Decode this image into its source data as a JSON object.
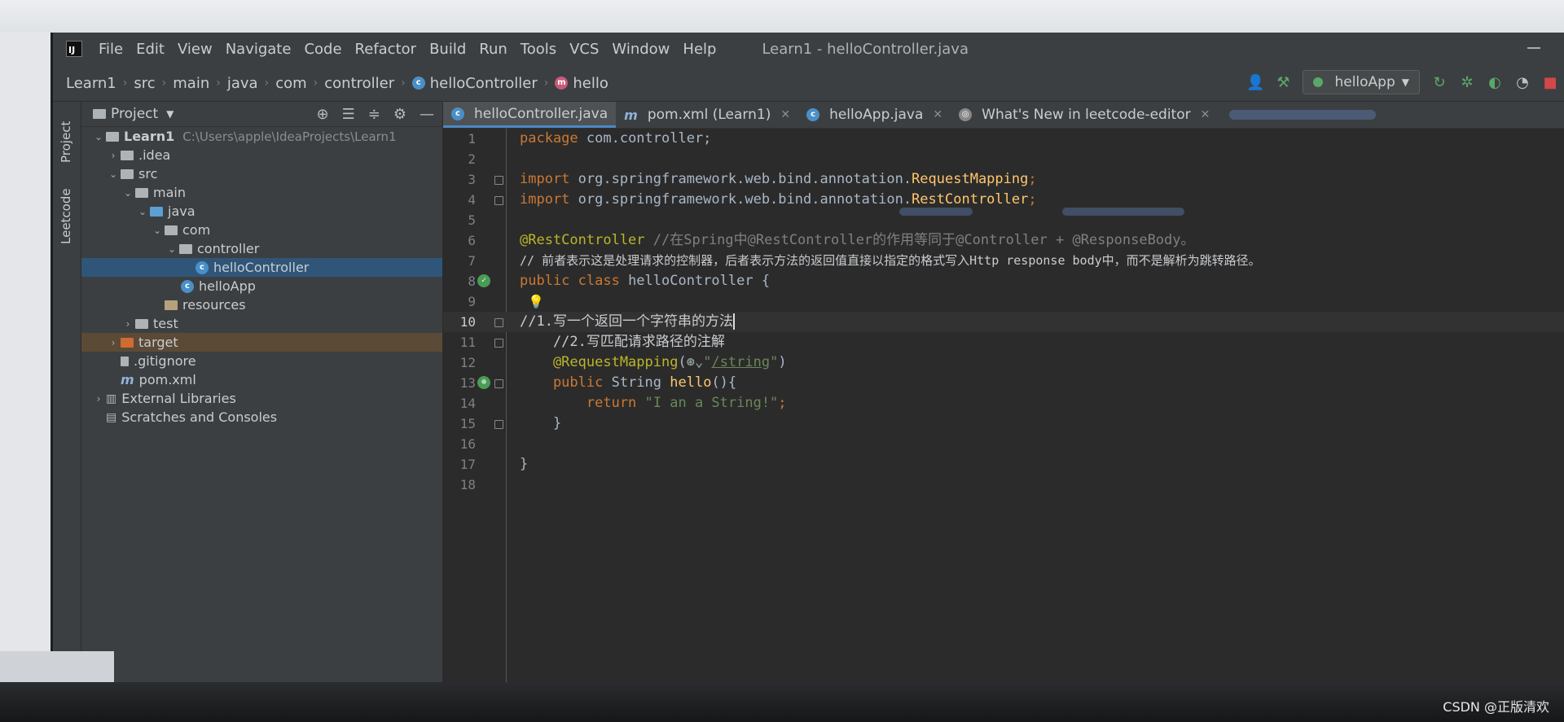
{
  "menu": {
    "items": [
      "File",
      "Edit",
      "View",
      "Navigate",
      "Code",
      "Refactor",
      "Build",
      "Run",
      "Tools",
      "VCS",
      "Window",
      "Help"
    ],
    "window_title": "Learn1 - helloController.java"
  },
  "breadcrumb": [
    "Learn1",
    "src",
    "main",
    "java",
    "com",
    "controller",
    "helloController",
    "hello"
  ],
  "toolbar": {
    "run_config": "helloApp"
  },
  "sidebar": {
    "project_label": "Project",
    "leetcode_label": "Leetcode"
  },
  "project": {
    "header": "Project",
    "tree": [
      {
        "label": "Learn1",
        "note": "C:\\Users\\apple\\IdeaProjects\\Learn1"
      },
      {
        "label": ".idea"
      },
      {
        "label": "src"
      },
      {
        "label": "main"
      },
      {
        "label": "java"
      },
      {
        "label": "com"
      },
      {
        "label": "controller"
      },
      {
        "label": "helloController"
      },
      {
        "label": "helloApp"
      },
      {
        "label": "resources"
      },
      {
        "label": "test"
      },
      {
        "label": "target"
      },
      {
        "label": ".gitignore"
      },
      {
        "label": "pom.xml"
      },
      {
        "label": "External Libraries"
      },
      {
        "label": "Scratches and Consoles"
      }
    ]
  },
  "tabs": [
    {
      "label": "helloController.java",
      "active": true
    },
    {
      "label": "pom.xml (Learn1)"
    },
    {
      "label": "helloApp.java"
    },
    {
      "label": "What's New in leetcode-editor"
    }
  ],
  "code": {
    "l1_kw": "package",
    "l1_rest": " com.controller;",
    "l3_kw": "import",
    "l3_pkg": " org.springframework.web.bind.annotation.",
    "l3_cls": "RequestMapping",
    "l3_end": ";",
    "l4_kw": "import",
    "l4_pkg": " org.springframework.web.bind.annotation.",
    "l4_cls": "RestController",
    "l4_end": ";",
    "l6_ann": "@RestController",
    "l6_cmt": " //在Spring中@RestController的作用等同于@Controller + @ResponseBody。",
    "l7_cmt": "// 前者表示这是处理请求的控制器，后者表示方法的返回值直接以指定的格式写入Http response body中，而不是解析为跳转路径。",
    "l8_kw": "public class",
    "l8_rest": " helloController {",
    "l10_cmt": "//1.写一个返回一个字符串的方法",
    "l11_cmt": "    //2.写匹配请求路径的注解",
    "l12_ann": "    @RequestMapping",
    "l12_open": "(",
    "l12_q1": "\"",
    "l12_path": "/string",
    "l12_q2": "\"",
    "l12_close": ")",
    "l13_kw": "    public",
    "l13_type": " String ",
    "l13_fn": "hello",
    "l13_rest": "(){",
    "l14_kw": "        return",
    "l14_str": " \"I an a String!\"",
    "l14_end": ";",
    "l15": "    }",
    "l17": "}"
  },
  "line_numbers": [
    "1",
    "2",
    "3",
    "4",
    "5",
    "6",
    "7",
    "8",
    "9",
    "10",
    "11",
    "12",
    "13",
    "14",
    "15",
    "16",
    "17",
    "18"
  ],
  "watermark": "CSDN @正版清欢"
}
